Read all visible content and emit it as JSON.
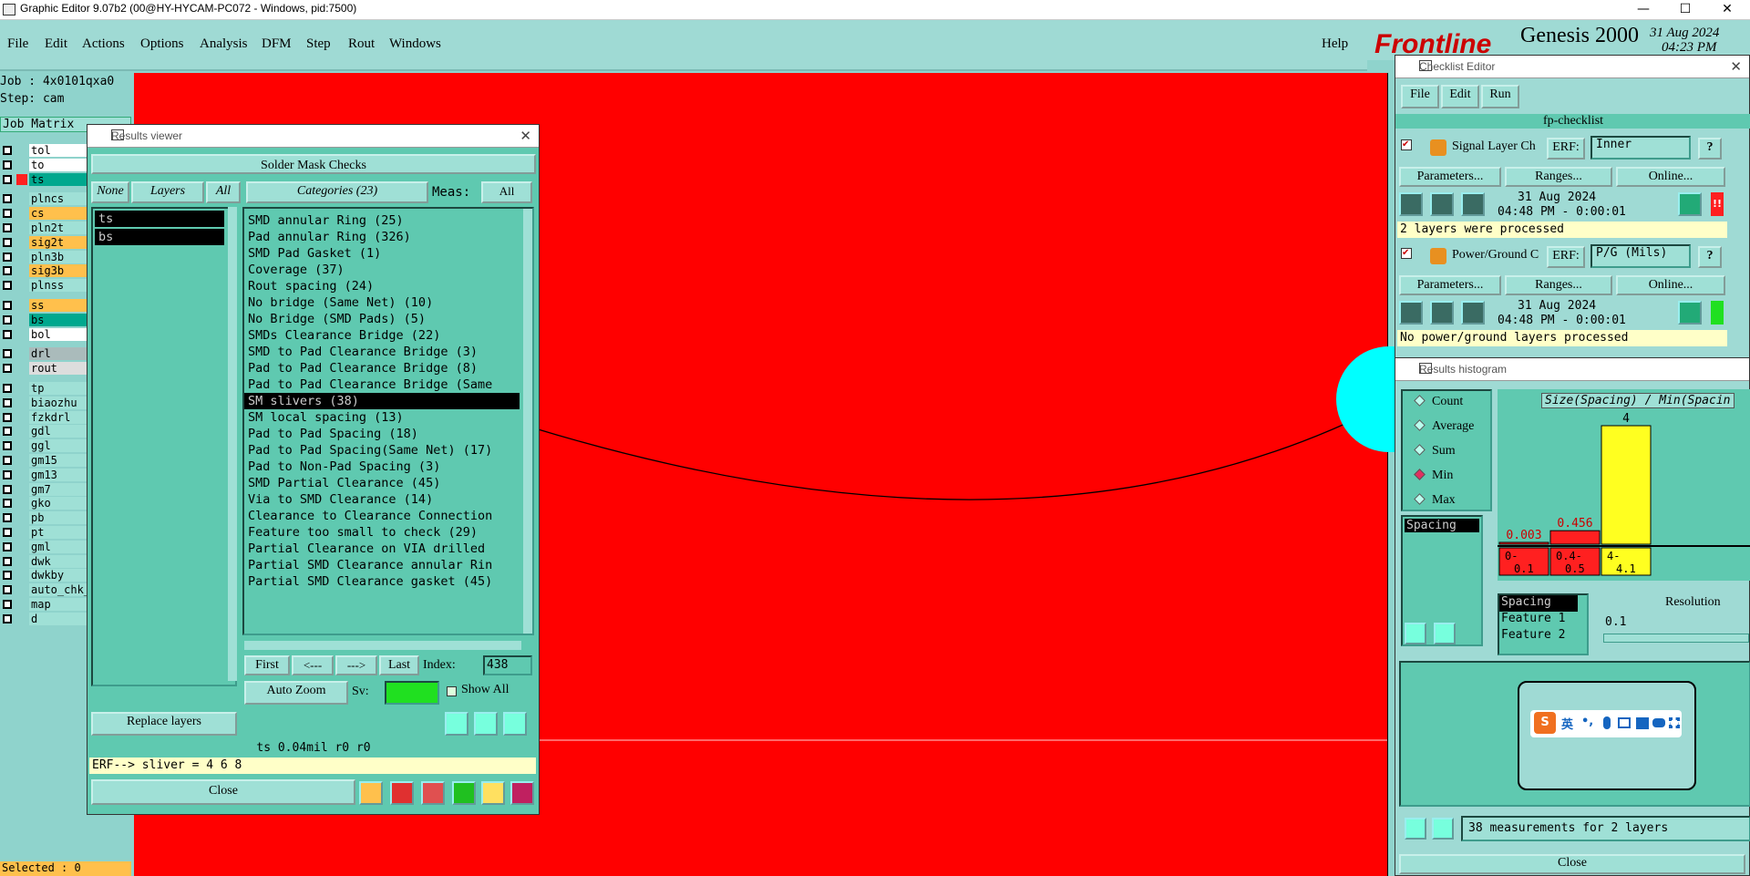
{
  "title_bar": {
    "title": "Graphic Editor 9.07b2 (00@HY-HYCAM-PC072 - Windows, pid:7500)",
    "minimize": "—",
    "maximize": "☐",
    "close": "✕"
  },
  "menu": {
    "items": [
      "File",
      "Edit",
      "Actions",
      "Options",
      "Analysis",
      "DFM",
      "Step",
      "Rout",
      "Windows"
    ],
    "help": "Help"
  },
  "brand": {
    "logo": "Frontline",
    "product": "Genesis 2000",
    "date": "31 Aug 2024",
    "time": "04:23 PM"
  },
  "job": {
    "job": "Job : 4x0101qxa0",
    "step": "Step: cam",
    "matrix_label": "Job Matrix",
    "selected": "Selected : 0"
  },
  "layers": [
    {
      "name": "tol",
      "color": "#ffffff"
    },
    {
      "name": "to",
      "color": "#ffffff"
    },
    {
      "name": "ts",
      "color": "#00a88e"
    },
    {
      "name": "plncs",
      "color": "#9fe0d6"
    },
    {
      "name": "cs",
      "color": "#ffc04c"
    },
    {
      "name": "pln2t",
      "color": "#9fe0d6"
    },
    {
      "name": "sig2t",
      "color": "#ffc04c"
    },
    {
      "name": "pln3b",
      "color": "#9fe0d6"
    },
    {
      "name": "sig3b",
      "color": "#ffc04c"
    },
    {
      "name": "plnss",
      "color": "#9fe0d6"
    },
    {
      "name": "ss",
      "color": "#ffc04c"
    },
    {
      "name": "bs",
      "color": "#00a88e"
    },
    {
      "name": "bol",
      "color": "#ffffff"
    },
    {
      "name": "drl",
      "color": "#aabbbb"
    },
    {
      "name": "rout",
      "color": "#dddddd"
    },
    {
      "name": "tp",
      "color": "#9fe0d6"
    },
    {
      "name": "biaozhu",
      "color": "#9fe0d6"
    },
    {
      "name": "fzkdrl",
      "color": "#9fe0d6"
    },
    {
      "name": "gdl",
      "color": "#9fe0d6"
    },
    {
      "name": "ggl",
      "color": "#9fe0d6"
    },
    {
      "name": "gm15",
      "color": "#9fe0d6"
    },
    {
      "name": "gm13",
      "color": "#9fe0d6"
    },
    {
      "name": "gm7",
      "color": "#9fe0d6"
    },
    {
      "name": "gko",
      "color": "#9fe0d6"
    },
    {
      "name": "pb",
      "color": "#9fe0d6"
    },
    {
      "name": "pt",
      "color": "#9fe0d6"
    },
    {
      "name": "gml",
      "color": "#9fe0d6"
    },
    {
      "name": "dwk",
      "color": "#9fe0d6"
    },
    {
      "name": "dwkby",
      "color": "#9fe0d6"
    },
    {
      "name": "auto_chk_",
      "color": "#9fe0d6"
    },
    {
      "name": "map",
      "color": "#9fe0d6"
    },
    {
      "name": "d",
      "color": "#9fe0d6"
    }
  ],
  "results_viewer": {
    "title": "Results viewer",
    "header": "Solder Mask Checks",
    "none": "None",
    "layers": "Layers",
    "all": "All",
    "categories": "Categories (23)",
    "meas_label": "Meas:",
    "meas_value": "All",
    "layer_list": [
      "ts",
      "bs"
    ],
    "category_list": [
      "SMD annular Ring (25)",
      "Pad annular Ring (326)",
      "SMD Pad Gasket (1)",
      "Coverage (37)",
      "Rout spacing (24)",
      "No bridge (Same Net) (10)",
      "No Bridge (SMD Pads) (5)",
      "SMDs Clearance Bridge (22)",
      "SMD to Pad Clearance Bridge (3)",
      "Pad to Pad Clearance Bridge (8)",
      "Pad to Pad Clearance Bridge (Same",
      "SM slivers (38)",
      "SM local spacing (13)",
      "Pad to Pad Spacing (18)",
      "Pad to Pad Spacing(Same Net) (17)",
      "Pad to Non-Pad Spacing (3)",
      "SMD Partial Clearance (45)",
      "Via to SMD Clearance (14)",
      "Clearance to Clearance Connection",
      "Feature too small to check (29)",
      "Partial Clearance on VIA drilled",
      "Partial SMD Clearance annular Rin",
      "Partial SMD Clearance gasket (45)"
    ],
    "selected_index": 11,
    "first": "First",
    "prev": "<---",
    "next": "--->",
    "last": "Last",
    "index_label": "Index:",
    "index_value": "438",
    "auto_zoom": "Auto Zoom",
    "sv_label": "Sv:",
    "show_all": "Show All",
    "replace_layers": "Replace layers",
    "status": "ts 0.04mil  r0  r0",
    "erf": "ERF--> sliver = 4 6 8",
    "close": "Close"
  },
  "checklist": {
    "title": "Checklist Editor",
    "menu": [
      "File",
      "Edit",
      "Run"
    ],
    "name": "fp-checklist",
    "items": [
      {
        "name": "Signal Layer Ch",
        "erf_label": "ERF:",
        "erf": "Inner",
        "params": "Parameters...",
        "ranges": "Ranges...",
        "online": "Online...",
        "date": "31 Aug 2024",
        "time": "04:48 PM - 0:00:01",
        "status": "2 layers were processed",
        "flag": "!!",
        "flag_color": "#ff2020"
      },
      {
        "name": "Power/Ground C",
        "erf_label": "ERF:",
        "erf": "P/G (Mils)",
        "params": "Parameters...",
        "ranges": "Ranges...",
        "online": "Online...",
        "date": "31 Aug 2024",
        "time": "04:48 PM - 0:00:01",
        "status": "No power/ground layers processed",
        "flag": "",
        "flag_color": "#20e020"
      }
    ],
    "help": "?"
  },
  "histogram": {
    "title": "Results histogram",
    "modes": [
      "Count",
      "Average",
      "Sum",
      "Min",
      "Max"
    ],
    "selected_mode": "Min",
    "list_item": "Spacing",
    "chart_title": "Size(Spacing) / Min(Spacin",
    "bars": [
      {
        "label": "0.003",
        "range": "0-\n0.1",
        "value": 0.003,
        "color": "#ff2020"
      },
      {
        "label": "0.456",
        "range": "0.4-\n0.5",
        "value": 0.456,
        "color": "#ff2020"
      },
      {
        "label": "4",
        "range": "4-\n4.1",
        "value": 4,
        "color": "#ffff20"
      }
    ],
    "measure_list": [
      "Spacing",
      "Feature 1",
      "Feature 2"
    ],
    "resolution_label": "Resolution",
    "resolution_value": "0.1",
    "summary": "38 measurements for 2 layers",
    "close": "Close"
  },
  "ime": {
    "logo": "S",
    "lang": "英",
    "punct": "•,"
  }
}
